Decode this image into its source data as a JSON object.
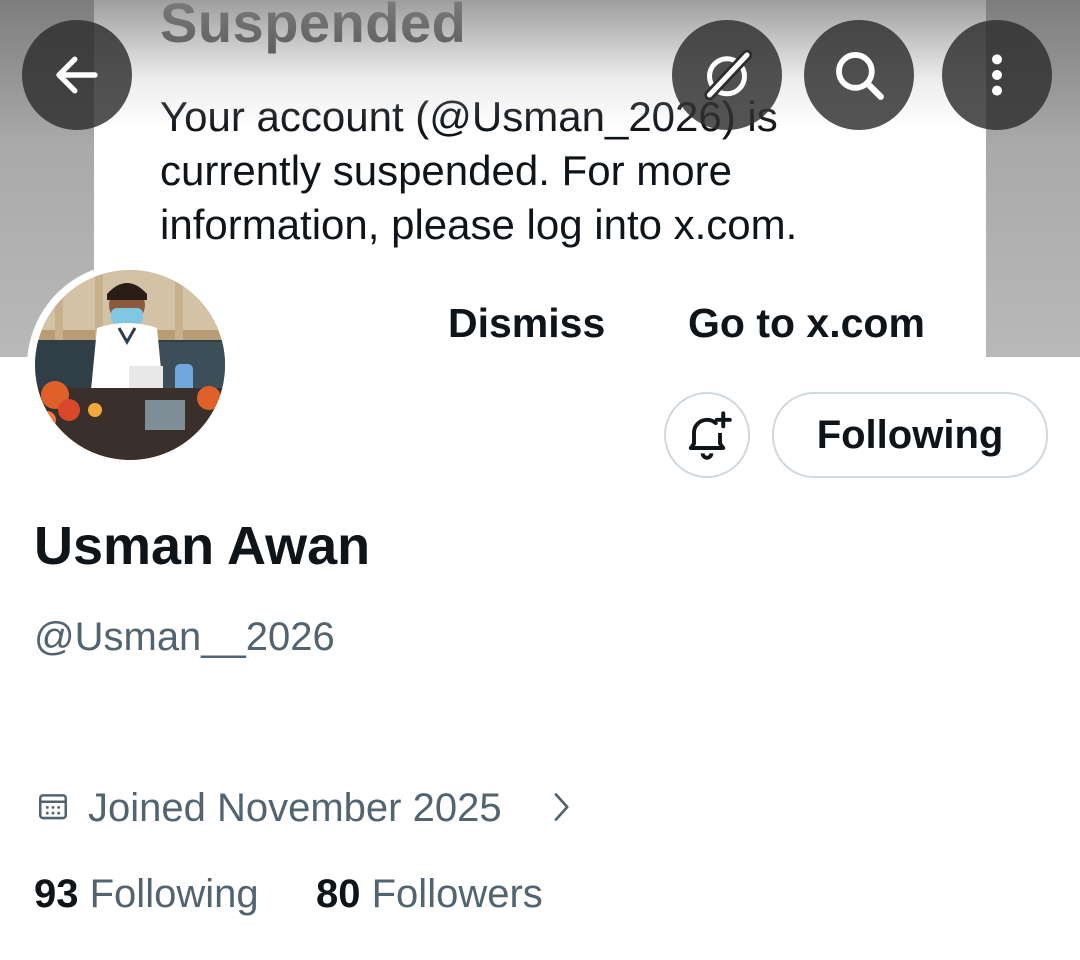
{
  "dialog": {
    "title": "Suspended",
    "body": "Your account (@Usman_2026) is currently suspended. For more information, please log into x.com.",
    "dismiss_label": "Dismiss",
    "go_label": "Go to x.com"
  },
  "header": {
    "back_icon": "arrow-left-icon",
    "grok_icon": "grok-icon",
    "search_icon": "search-icon",
    "more_icon": "more-vertical-icon"
  },
  "profile": {
    "name": "Usman Awan",
    "handle": "@Usman__2026",
    "joined": "Joined November 2025",
    "follow_button_label": "Following",
    "notify_icon": "bell-plus-icon",
    "stats": {
      "following_count": "93",
      "following_label": "Following",
      "followers_count": "80",
      "followers_label": "Followers"
    }
  },
  "colors": {
    "text_primary": "#0f1419",
    "text_secondary": "#536471",
    "border": "#cfd9de"
  }
}
